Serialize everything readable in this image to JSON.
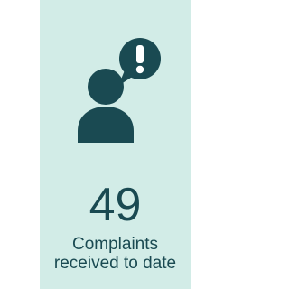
{
  "stat": {
    "value": "49",
    "label_line1": "Complaints",
    "label_line2": "received to date"
  },
  "icon": {
    "name": "person-alert-speech-bubble-icon"
  },
  "colors": {
    "card_background": "#d2ece7",
    "accent": "#1a4a52"
  }
}
